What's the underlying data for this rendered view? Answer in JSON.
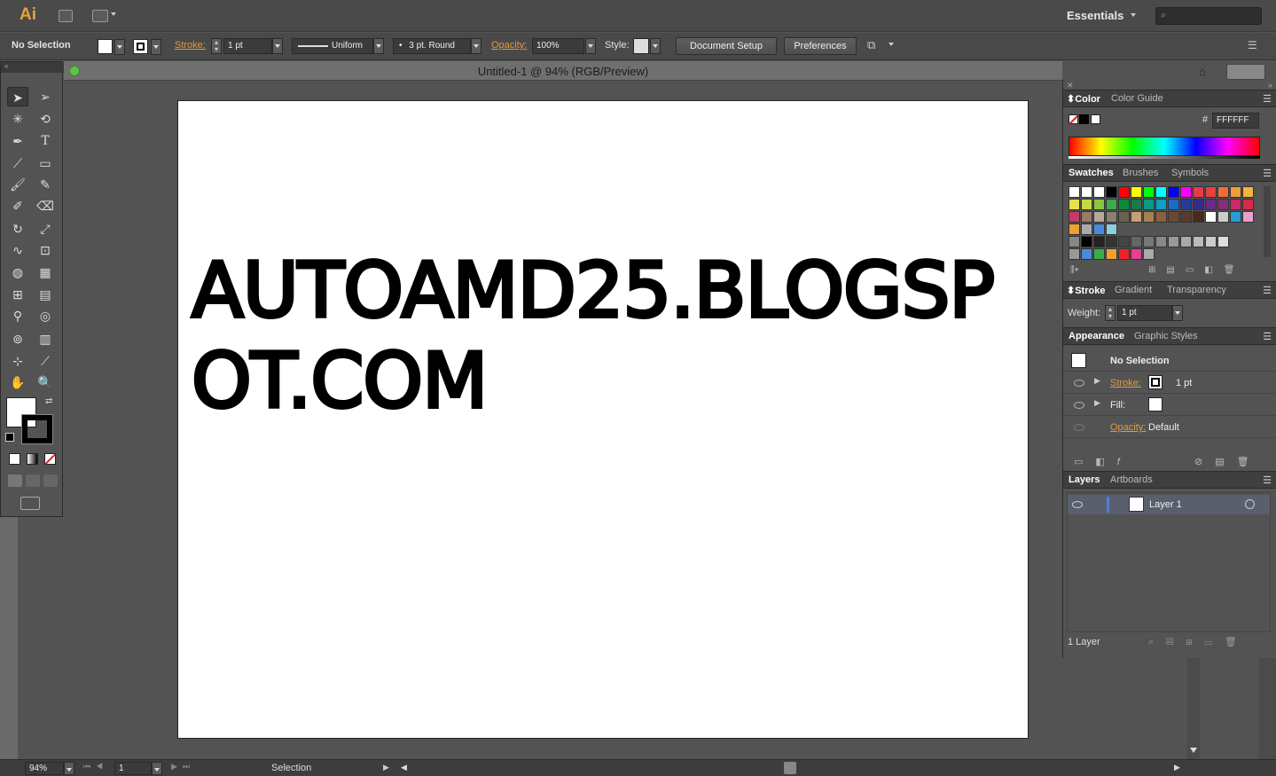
{
  "app": {
    "logo": "Ai",
    "workspace": "Essentials"
  },
  "control_bar": {
    "selection": "No Selection",
    "stroke_label": "Stroke:",
    "stroke_weight": "1 pt",
    "stroke_profile": "Uniform",
    "brush": "3 pt. Round",
    "opacity_label": "Opacity:",
    "opacity": "100%",
    "style_label": "Style:",
    "document_setup": "Document Setup",
    "preferences": "Preferences"
  },
  "document": {
    "title": "Untitled-1 @ 94% (RGB/Preview)"
  },
  "artwork": {
    "line1": "AUTOAMD25.BLOGSP",
    "line2": "OT.COM"
  },
  "color_panel": {
    "tabs": [
      "Color",
      "Color Guide"
    ],
    "hex_prefix": "#",
    "hex": "FFFFFF"
  },
  "swatches_panel": {
    "tabs": [
      "Swatches",
      "Brushes",
      "Symbols"
    ]
  },
  "stroke_panel": {
    "tabs": [
      "Stroke",
      "Gradient",
      "Transparency"
    ],
    "weight_label": "Weight:",
    "weight": "1 pt"
  },
  "appearance_panel": {
    "tabs": [
      "Appearance",
      "Graphic Styles"
    ],
    "title": "No Selection",
    "stroke_label": "Stroke:",
    "stroke_value": "1 pt",
    "fill_label": "Fill:",
    "opacity_label": "Opacity:",
    "opacity_value": "Default"
  },
  "layers_panel": {
    "tabs": [
      "Layers",
      "Artboards"
    ],
    "layer_name": "Layer 1",
    "count": "1 Layer"
  },
  "status_bar": {
    "zoom": "94%",
    "artboard_num": "1",
    "tool": "Selection"
  },
  "colors": {
    "accent_orange": "#e39a3c",
    "layer_highlight": "#5a5f6e",
    "bg": "#535353"
  }
}
